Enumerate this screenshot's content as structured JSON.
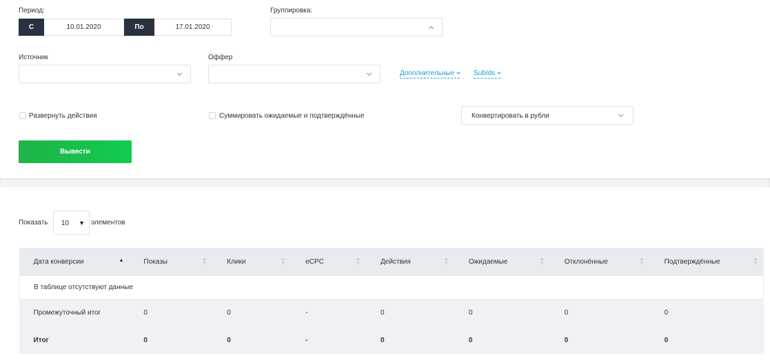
{
  "filters": {
    "period_label": "Период:",
    "from_tag": "С",
    "from_date": "10.01.2020",
    "to_tag": "По",
    "to_date": "17.01.2020",
    "grouping_label": "Группировка:",
    "grouping_value": "",
    "source_label": "Источник",
    "source_value": "",
    "offer_label": "Оффер",
    "offer_value": "",
    "extra_link": "Дополнительные",
    "subids_link": "SubIds",
    "expand_actions_label": "Развернуть действия",
    "sum_label": "Суммировать ожидаемые и подтверждённые",
    "convert_value": "Конвертировать в рубли",
    "submit_label": "Вывести"
  },
  "table_controls": {
    "show_label": "Показать",
    "page_length": "10",
    "elements_label": "элементов"
  },
  "table": {
    "headers": [
      "Дата конверсии",
      "Показы",
      "Клики",
      "eCPC",
      "Действия",
      "Ожидаемые",
      "Отклонённые",
      "Подтверждённые"
    ],
    "empty_message": "В таблице отсутствуют данные",
    "subtotal": [
      "Промежуточный итог",
      "0",
      "0",
      "-",
      "0",
      "0",
      "0",
      "0"
    ],
    "total": [
      "Итог",
      "0",
      "0",
      "-",
      "0",
      "0",
      "0",
      "0"
    ]
  }
}
